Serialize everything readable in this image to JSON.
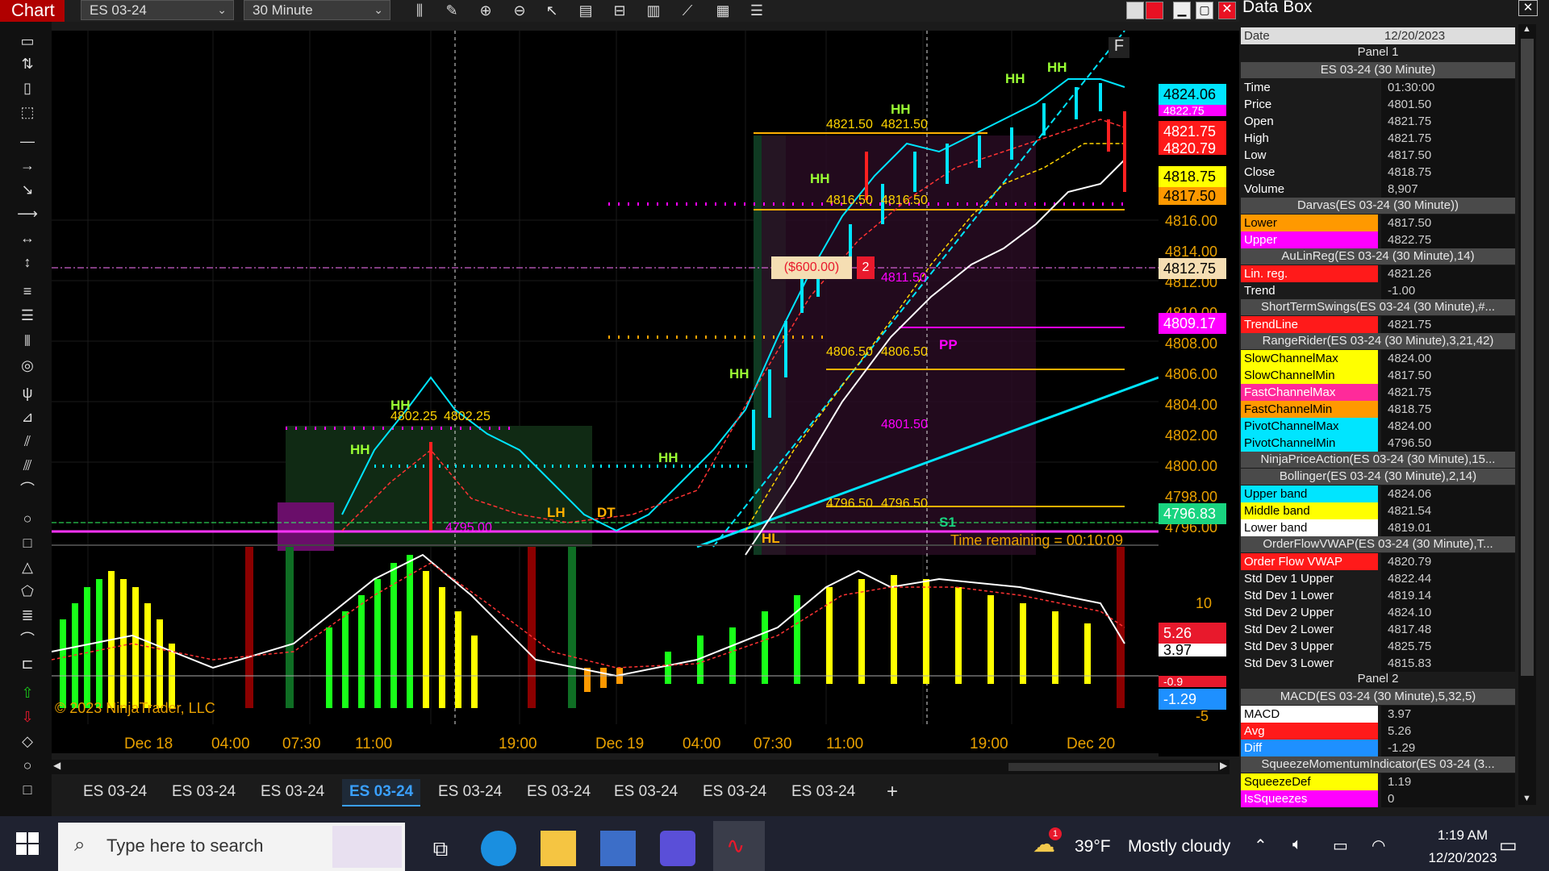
{
  "window": {
    "title": "Chart",
    "instrument": "ES 03-24",
    "interval": "30 Minute"
  },
  "chart": {
    "float_button": "F",
    "copyright": "© 2023 NinjaTrader, LLC",
    "time_remaining": "Time remaining = 00:10:09",
    "pnl_label": "($600.00)",
    "position_qty": "2",
    "price_labels": [
      {
        "text": "4824.06",
        "bg": "#00e5ff",
        "fg": "#000"
      },
      {
        "text": "4822.75",
        "bg": "#ff00ff",
        "fg": "#fff"
      },
      {
        "text": "4821.75",
        "bg": "#ff1a1a",
        "fg": "#fff"
      },
      {
        "text": "4820.79",
        "bg": "#ff1a1a",
        "fg": "#fff"
      },
      {
        "text": "4818.75",
        "bg": "#ffff00",
        "fg": "#000"
      },
      {
        "text": "4817.50",
        "bg": "#ff9900",
        "fg": "#000"
      },
      {
        "text": "4812.75",
        "bg": "#f5deb3",
        "fg": "#000"
      },
      {
        "text": "4809.17",
        "bg": "#ff00ff",
        "fg": "#fff"
      },
      {
        "text": "4796.83",
        "bg": "#19d480",
        "fg": "#fff"
      }
    ],
    "y_ticks": [
      "4816.00",
      "4814.00",
      "4812.00",
      "4810.00",
      "4808.00",
      "4806.00",
      "4804.00",
      "4802.00",
      "4800.00",
      "4798.00",
      "4796.00"
    ],
    "lower_ticks": [
      "10",
      "-5"
    ],
    "lower_labels": [
      {
        "text": "5.26",
        "bg": "#e8192c",
        "fg": "#fff"
      },
      {
        "text": "3.97",
        "bg": "#ffffff",
        "fg": "#000"
      },
      {
        "text": "-0.9",
        "bg": "#e8192c",
        "fg": "#fff"
      },
      {
        "text": "-1.29",
        "bg": "#1e90ff",
        "fg": "#fff"
      }
    ],
    "x_labels": [
      "Dec 18",
      "04:00",
      "07:30",
      "11:00",
      "19:00",
      "Dec 19",
      "04:00",
      "07:30",
      "11:00",
      "19:00",
      "Dec 20"
    ],
    "swing_labels": [
      "HH",
      "HH",
      "HH",
      "HH",
      "HH",
      "HH",
      "HH",
      "HH",
      "LH",
      "DT",
      "HL",
      "PP",
      "S1"
    ],
    "level_labels": [
      "4821.50",
      "4821.50",
      "4816.50",
      "4816.50",
      "4811.50",
      "4806.50",
      "4806.50",
      "4802.25",
      "4802.25",
      "4801.50",
      "4796.50",
      "4796.50",
      "4795.00"
    ]
  },
  "tabs": [
    "ES 03-24",
    "ES 03-24",
    "ES 03-24",
    "ES 03-24",
    "ES 03-24",
    "ES 03-24",
    "ES 03-24",
    "ES 03-24",
    "ES 03-24",
    "+"
  ],
  "databox": {
    "title": "Data Box",
    "date_key": "Date",
    "date_value": "12/20/2023",
    "rows": [
      {
        "type": "panel",
        "text": "Panel 1"
      },
      {
        "type": "hdr",
        "text": "ES 03-24 (30 Minute)"
      },
      {
        "type": "row",
        "k": "Time",
        "v": "01:30:00",
        "bg": ""
      },
      {
        "type": "row",
        "k": "Price",
        "v": "4801.50",
        "bg": ""
      },
      {
        "type": "row",
        "k": "Open",
        "v": "4821.75",
        "bg": ""
      },
      {
        "type": "row",
        "k": "High",
        "v": "4821.75",
        "bg": ""
      },
      {
        "type": "row",
        "k": "Low",
        "v": "4817.50",
        "bg": ""
      },
      {
        "type": "row",
        "k": "Close",
        "v": "4818.75",
        "bg": ""
      },
      {
        "type": "row",
        "k": "Volume",
        "v": "8,907",
        "bg": ""
      },
      {
        "type": "hdr",
        "text": "Darvas(ES 03-24 (30 Minute))"
      },
      {
        "type": "row",
        "k": "Lower",
        "v": "4817.50",
        "bg": "#ff9900"
      },
      {
        "type": "row",
        "k": "Upper",
        "v": "4822.75",
        "bg": "#ff00ff"
      },
      {
        "type": "hdr",
        "text": "AuLinReg(ES 03-24 (30 Minute),14)"
      },
      {
        "type": "row",
        "k": "Lin. reg.",
        "v": "4821.26",
        "bg": "#ff1a1a"
      },
      {
        "type": "row",
        "k": "Trend",
        "v": "-1.00",
        "bg": ""
      },
      {
        "type": "hdr",
        "text": "ShortTermSwings(ES 03-24 (30 Minute),#..."
      },
      {
        "type": "row",
        "k": "TrendLine",
        "v": "4821.75",
        "bg": "#ff1a1a"
      },
      {
        "type": "hdr",
        "text": "RangeRider(ES 03-24 (30 Minute),3,21,42)"
      },
      {
        "type": "row",
        "k": "SlowChannelMax",
        "v": "4824.00",
        "bg": "#ffff00"
      },
      {
        "type": "row",
        "k": "SlowChannelMin",
        "v": "4817.50",
        "bg": "#ffff00"
      },
      {
        "type": "row",
        "k": "FastChannelMax",
        "v": "4821.75",
        "bg": "#ff2a9a"
      },
      {
        "type": "row",
        "k": "FastChannelMin",
        "v": "4818.75",
        "bg": "#ff9900"
      },
      {
        "type": "row",
        "k": "PivotChannelMax",
        "v": "4824.00",
        "bg": "#00e5ff"
      },
      {
        "type": "row",
        "k": "PivotChannelMin",
        "v": "4796.50",
        "bg": "#00e5ff"
      },
      {
        "type": "hdr",
        "text": "NinjaPriceAction(ES 03-24 (30 Minute),15..."
      },
      {
        "type": "hdr",
        "text": "Bollinger(ES 03-24 (30 Minute),2,14)"
      },
      {
        "type": "row",
        "k": "Upper band",
        "v": "4824.06",
        "bg": "#00e5ff"
      },
      {
        "type": "row",
        "k": "Middle band",
        "v": "4821.54",
        "bg": "#ffff00"
      },
      {
        "type": "row",
        "k": "Lower band",
        "v": "4819.01",
        "bg": "#ffffff"
      },
      {
        "type": "hdr",
        "text": "OrderFlowVWAP(ES 03-24 (30 Minute),T..."
      },
      {
        "type": "row",
        "k": "Order Flow VWAP",
        "v": "4820.79",
        "bg": "#ff1a1a"
      },
      {
        "type": "row",
        "k": "Std Dev 1 Upper",
        "v": "4822.44",
        "bg": ""
      },
      {
        "type": "row",
        "k": "Std Dev 1 Lower",
        "v": "4819.14",
        "bg": ""
      },
      {
        "type": "row",
        "k": "Std Dev 2 Upper",
        "v": "4824.10",
        "bg": ""
      },
      {
        "type": "row",
        "k": "Std Dev 2 Lower",
        "v": "4817.48",
        "bg": ""
      },
      {
        "type": "row",
        "k": "Std Dev 3 Upper",
        "v": "4825.75",
        "bg": ""
      },
      {
        "type": "row",
        "k": "Std Dev 3 Lower",
        "v": "4815.83",
        "bg": ""
      },
      {
        "type": "panel",
        "text": "Panel 2"
      },
      {
        "type": "hdr",
        "text": "MACD(ES 03-24 (30 Minute),5,32,5)"
      },
      {
        "type": "row",
        "k": "MACD",
        "v": "3.97",
        "bg": "#ffffff"
      },
      {
        "type": "row",
        "k": "Avg",
        "v": "5.26",
        "bg": "#ff1a1a"
      },
      {
        "type": "row",
        "k": "Diff",
        "v": "-1.29",
        "bg": "#1e90ff"
      },
      {
        "type": "hdr",
        "text": "SqueezeMomentumIndicator(ES 03-24 (3..."
      },
      {
        "type": "row",
        "k": "SqueezeDef",
        "v": "1.19",
        "bg": "#ffff00"
      },
      {
        "type": "row",
        "k": "IsSqueezes",
        "v": "0",
        "bg": "#ff00ff"
      }
    ]
  },
  "taskbar": {
    "search_placeholder": "Type here to search",
    "weather_temp": "39°F",
    "weather_desc": "Mostly cloudy",
    "weather_badge": "1",
    "time": "1:19 AM",
    "date": "12/20/2023"
  }
}
